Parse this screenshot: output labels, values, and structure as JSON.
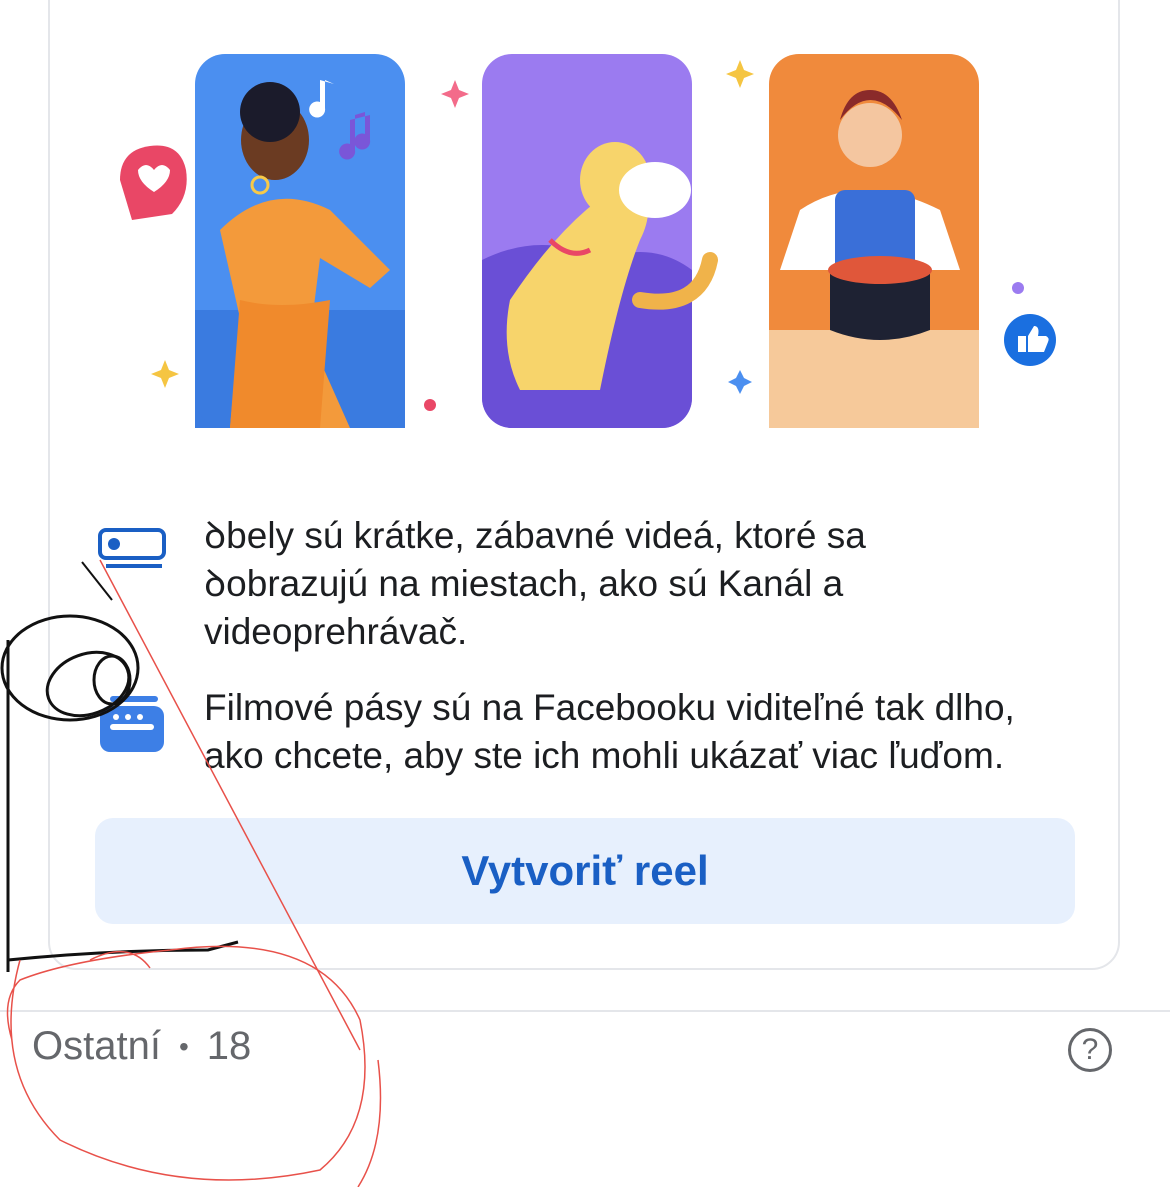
{
  "card": {
    "info": [
      {
        "icon": "reels-icon",
        "text": "ꝺbely sú krátke, zábavné videá, ktoré sa\nꝺobrazujú na miestach, ako sú Kanál a\nvideoprehrávač."
      },
      {
        "icon": "film-strip-icon",
        "text": "Filmové pásy sú na Facebooku viditeľné tak dlho,\nako chcete, aby ste ich mohli ukázať viac ľuďom."
      }
    ],
    "create_button_label": "Vytvoriť reel"
  },
  "section": {
    "title": "Ostatní",
    "separator": "•",
    "count": "18",
    "help_icon": "?"
  },
  "colors": {
    "accent": "#1a5fc4",
    "button_bg": "#e7f0fd",
    "muted": "#65676b",
    "panel_blue": "#4b8ff0",
    "panel_purple": "#9b7bf0",
    "panel_orange": "#f08a3c",
    "scribble_red": "#e8514a"
  }
}
